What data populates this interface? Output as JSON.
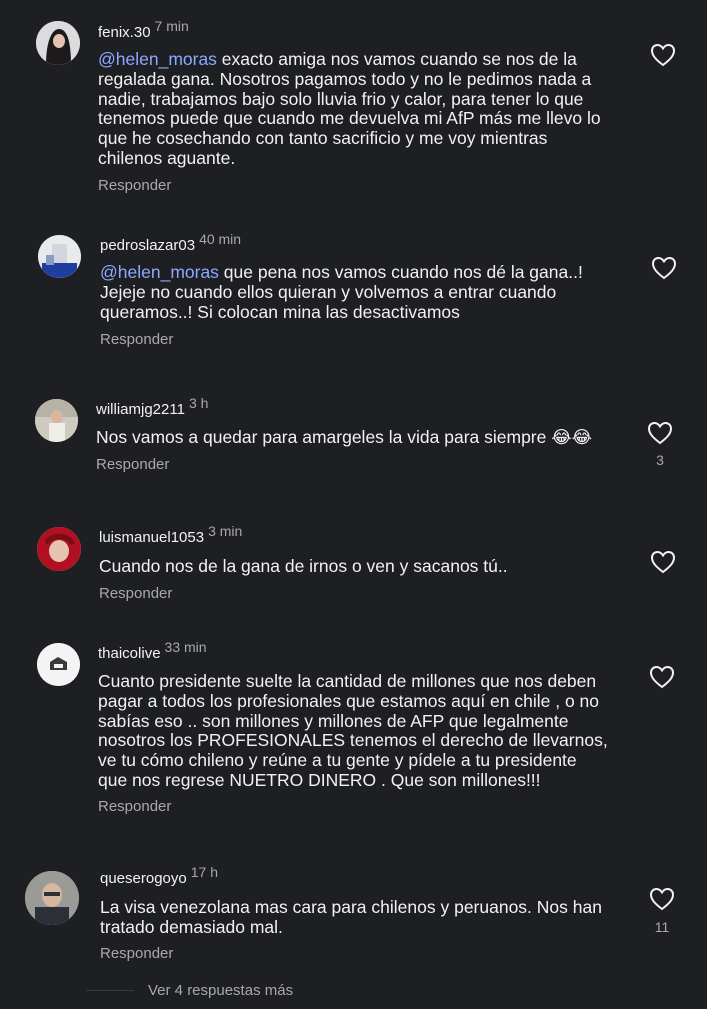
{
  "comments": [
    {
      "user": "fenix.30",
      "time": "7 min",
      "mention": "@helen_moras",
      "text": " exacto amiga nos vamos cuando se nos de la\nregalada gana. Nosotros pagamos todo y no le pedimos nada a\nnadie, trabajamos bajo solo lluvia frio y calor, para tener lo que\ntenemos puede que cuando me devuelva mi AfP más me llevo lo\nque he cosechando con tanto sacrificio y me voy mientras\nchilenos aguante.",
      "reply": "Responder",
      "likes": ""
    },
    {
      "user": "pedroslazar03",
      "time": "40 min",
      "mention": "@helen_moras",
      "text": " que pena nos vamos cuando nos dé la gana..!\nJejeje no cuando ellos quieran y volvemos a entrar cuando\nqueramos..! Si colocan mina las desactivamos",
      "reply": "Responder",
      "likes": ""
    },
    {
      "user": "williamjg2211",
      "time": "3 h",
      "mention": "",
      "text": "Nos vamos a quedar para amargeles la vida para siempre 😂😂",
      "reply": "Responder",
      "likes": "3"
    },
    {
      "user": "luismanuel1053",
      "time": "3 min",
      "mention": "",
      "text": "Cuando nos de la gana de irnos o ven y sacanos tú..",
      "reply": "Responder",
      "likes": ""
    },
    {
      "user": "thaicolive",
      "time": "33 min",
      "mention": "",
      "text": "Cuanto presidente suelte la cantidad de millones que nos deben\npagar a todos los profesionales que estamos aquí en chile , o no\nsabías eso .. son millones y millones de AFP que legalmente\nnosotros los PROFESIONALES tenemos el derecho de llevarnos,\nve tu cómo chileno y reúne a tu gente y pídele a tu presidente\nque nos regrese NUETRO DINERO . Que son millones!!!",
      "reply": "Responder",
      "likes": ""
    },
    {
      "user": "queserogoyo",
      "time": "17 h",
      "mention": "",
      "text": "La visa venezolana mas cara para chilenos y peruanos. Nos han\ntratado demasiado mal.",
      "reply": "Responder",
      "likes": "11"
    }
  ],
  "more_replies": "Ver 4 respuestas más",
  "icons": {
    "like": "heart-icon"
  }
}
